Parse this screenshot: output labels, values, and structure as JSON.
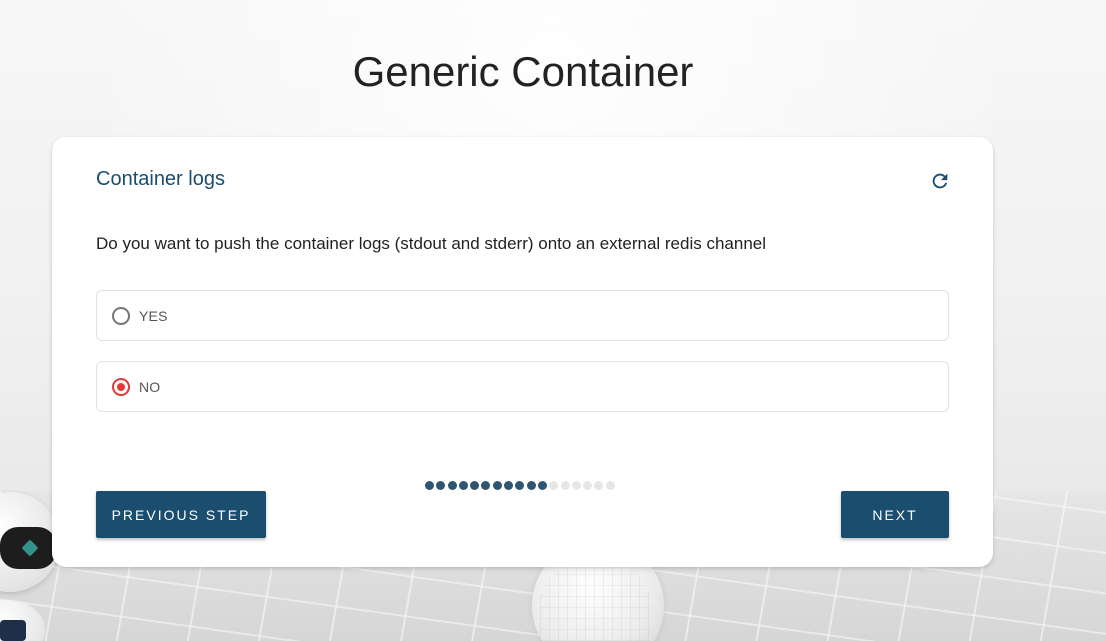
{
  "page": {
    "title": "Generic Container"
  },
  "card": {
    "title": "Container logs",
    "reset_icon": "refresh-icon",
    "question": "Do you want to push the container logs (stdout and stderr) onto an external redis channel",
    "options": [
      {
        "label": "YES",
        "selected": false
      },
      {
        "label": "NO",
        "selected": true
      }
    ],
    "progress": {
      "completed_steps": 11,
      "total_steps": 17
    },
    "buttons": {
      "previous": "PREVIOUS STEP",
      "next": "NEXT"
    }
  },
  "colors": {
    "accent": "#1b4d6e",
    "radio_selected": "#e53935",
    "progress_done": "#2e5572",
    "progress_todo": "#e6e6e6"
  }
}
